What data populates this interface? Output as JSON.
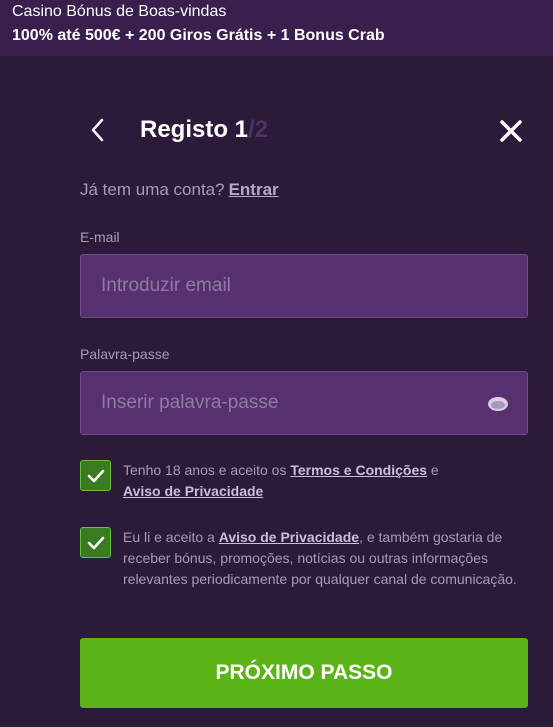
{
  "promo": {
    "title": "Casino Bónus de Boas-vindas",
    "subtitle": "100% até 500€ + 200 Giros Grátis + 1 Bonus Crab"
  },
  "header": {
    "title_main": "Registo 1",
    "title_total": "/2"
  },
  "login": {
    "question": "Já tem uma conta?",
    "link": "Entrar"
  },
  "email": {
    "label": "E-mail",
    "placeholder": "Introduzir email"
  },
  "password": {
    "label": "Palavra-passe",
    "placeholder": "Inserir palavra-passe"
  },
  "consent_age": {
    "text_before": "Tenho 18 anos e aceito os",
    "link_terms": "Termos e Condições",
    "text_and": "e",
    "link_privacy": "Aviso de Privacidade",
    "checked": true
  },
  "consent_marketing": {
    "text_before": "Eu li e aceito a",
    "link_privacy": "Aviso de Privacidade",
    "text_after": ", e também gostaria de receber bónus, promoções, notícias ou outras informações relevantes periodicamente por qualquer canal de comunicação.",
    "checked": true
  },
  "next_button": "PRÓXIMO PASSO",
  "colors": {
    "accent_green": "#5bb317",
    "field_bg": "#57306f",
    "background": "#2b1a3a"
  },
  "icons": {
    "back": "chevron-left-icon",
    "close": "close-icon",
    "eye": "eye-icon",
    "check": "checkmark-icon"
  }
}
